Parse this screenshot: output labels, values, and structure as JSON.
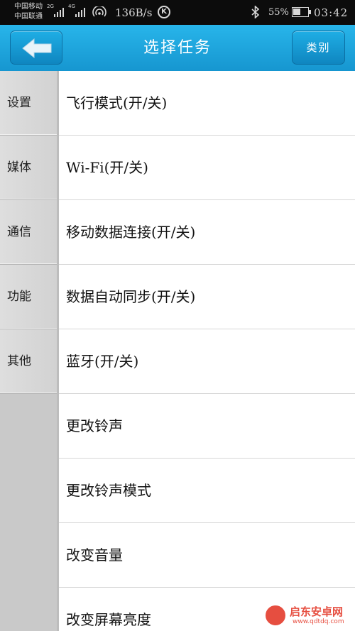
{
  "status_bar": {
    "carrier_1": "中国移动",
    "carrier_2": "中国联通",
    "net_1": "2G",
    "net_2": "4G",
    "speed": "136B/s",
    "battery_pct": "55%",
    "battery_level": 0.55,
    "time": "03:42"
  },
  "title_bar": {
    "title": "选择任务",
    "category_label": "类别",
    "back_icon": "back-arrow-icon"
  },
  "sidebar": {
    "items": [
      {
        "label": "设置"
      },
      {
        "label": "媒体"
      },
      {
        "label": "通信"
      },
      {
        "label": "功能"
      },
      {
        "label": "其他"
      }
    ]
  },
  "tasks": {
    "items": [
      {
        "label": "飞行模式(开/关)"
      },
      {
        "label": "Wi-Fi(开/关)"
      },
      {
        "label": "移动数据连接(开/关)"
      },
      {
        "label": "数据自动同步(开/关)"
      },
      {
        "label": "蓝牙(开/关)"
      },
      {
        "label": "更改铃声"
      },
      {
        "label": "更改铃声模式"
      },
      {
        "label": "改变音量"
      },
      {
        "label": "改变屏幕亮度"
      }
    ]
  },
  "watermark": {
    "text": "启东安卓网",
    "url": "www.qdtdq.com"
  },
  "colors": {
    "title_bar": "#1fa6df",
    "sidebar": "#d6d6d6",
    "status_bar": "#0c0c0c"
  }
}
